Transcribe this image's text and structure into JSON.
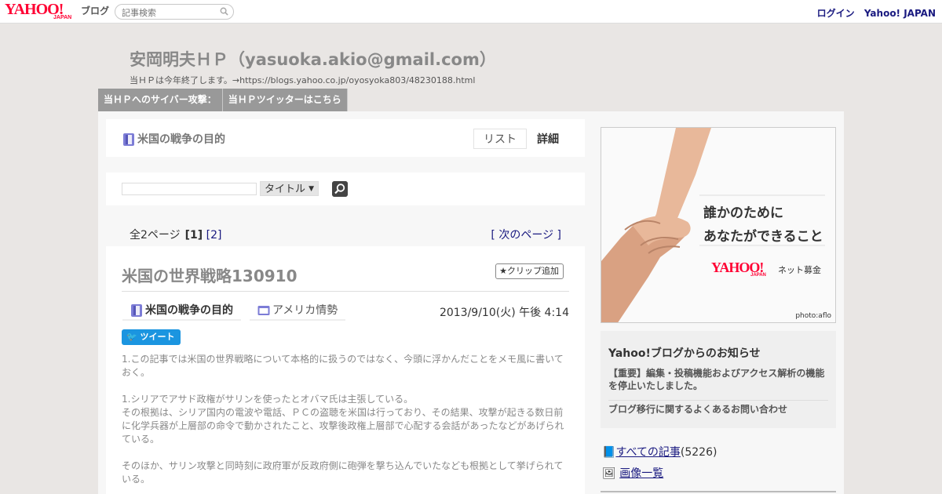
{
  "topbar": {
    "logo_yahoo": "YAHOO!",
    "logo_japan": "JAPAN",
    "logo_blog": "ブログ",
    "search_placeholder": "記事検索",
    "login": "ログイン",
    "yahoo_japan": "Yahoo! JAPAN"
  },
  "blog": {
    "title": "安岡明夫ＨＰ（yasuoka.akio@gmail.com）",
    "subtitle": "当ＨＰは今年終了します。→https://blogs.yahoo.co.jp/oyosyoka803/48230188.html",
    "nav": [
      "当ＨＰへのサイバー攻撃：",
      "当ＨＰツイッターはこちら"
    ]
  },
  "header_card": {
    "category_title": "米国の戦争の目的",
    "tabs": [
      "リスト",
      "詳細"
    ],
    "active_tab": "詳細"
  },
  "search": {
    "select_value": "タイトル"
  },
  "pager": {
    "label": "全2ページ",
    "current": "[1]",
    "page2": "[2]",
    "next_open": "[ ",
    "next": "次のページ",
    "next_close": " ]"
  },
  "article": {
    "title": "米国の世界戦略130910",
    "clip_label": "クリップ追加",
    "category1": "米国の戦争の目的",
    "category2": "アメリカ情勢",
    "date": "2013/9/10(火) 午後 4:14",
    "tweet_label": "ツイート",
    "paragraphs": [
      "1.この記事では米国の世界戦略について本格的に扱うのではなく、今頭に浮かんだことをメモ風に書いておく。",
      "1.シリアでアサド政権がサリンを使ったとオバマ氏は主張している。\nその根拠は、シリア国内の電波や電話、ＰＣの盗聴を米国は行っており、その結果、攻撃が起きる数日前に化学兵器が上層部の命令で動かされたこと、攻撃後政権上層部で心配する会話があったなどがあげられている。",
      "そのほか、サリン攻撃と同時刻に政府軍が反政府側に砲弾を撃ち込んでいたなども根拠として挙げられている。"
    ]
  },
  "ad": {
    "line1": "誰かのために",
    "line2": "あなたができること",
    "yahoo": "YAHOO!",
    "japan": "JAPAN",
    "net": "ネット募金",
    "photo": "photo:aflo"
  },
  "notice": {
    "heading": "Yahoo!ブログからのお知らせ",
    "items": [
      "【重要】編集・投稿機能およびアクセス解析の機能を停止いたしました。",
      "ブログ移行に関するよくあるお問い合わせ"
    ]
  },
  "sidebar": {
    "all_articles": "すべての記事",
    "all_count": "(5226)",
    "images": "画像一覧"
  },
  "colors": {
    "yahoo_red": "#ff0033",
    "link_navy": "#1a1a80",
    "nav_gray": "#999999",
    "tweet_blue": "#1b95e0"
  }
}
